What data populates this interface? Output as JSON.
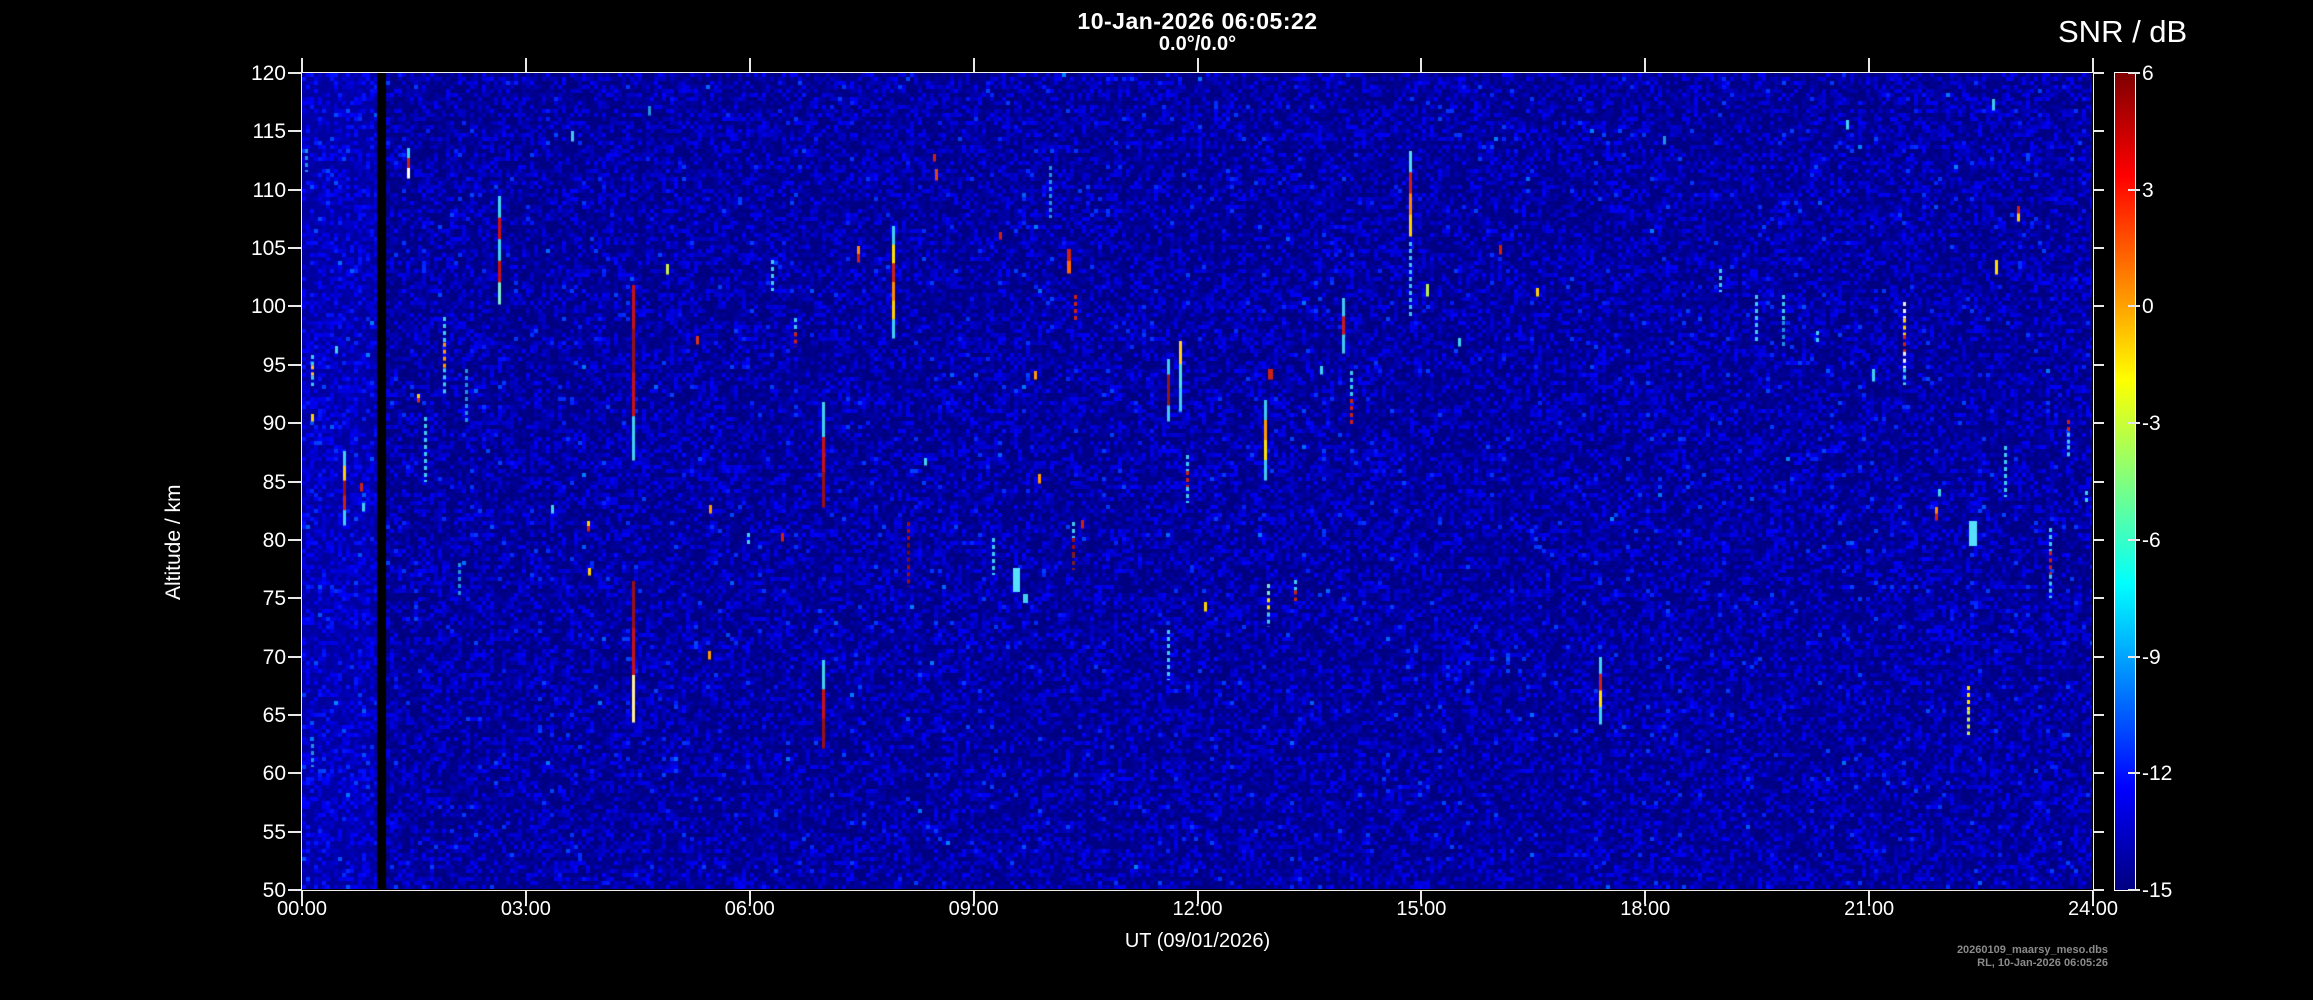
{
  "header": {
    "datetime": "10-Jan-2026 06:05:22",
    "beam": "0.0°/0.0°"
  },
  "colorbar": {
    "title": "SNR / dB",
    "min": -15,
    "max": 6,
    "tick_values": [
      6,
      3,
      0,
      -3,
      -6,
      -9,
      -12,
      -15
    ],
    "colormap": "jet"
  },
  "axes": {
    "y_label": "Altitude / km",
    "y_tick_values": [
      120,
      115,
      110,
      105,
      100,
      95,
      90,
      85,
      80,
      75,
      70,
      65,
      60,
      55,
      50
    ],
    "x_label": "UT (09/01/2026)",
    "x_tick_labels": [
      "00:00",
      "03:00",
      "06:00",
      "09:00",
      "12:00",
      "15:00",
      "18:00",
      "21:00",
      "24:00"
    ],
    "x_tick_hours": [
      0,
      3,
      6,
      9,
      12,
      15,
      18,
      21,
      24
    ]
  },
  "footer": {
    "line1": "20260109_maarsy_meso.dbs",
    "line2": "RL, 10-Jan-2026 06:05:26"
  },
  "colors": {
    "background": "#000000",
    "axis": "#efefef",
    "noise_floor": "#000080",
    "text": "#ffffff",
    "footer_text": "#8a8a8a"
  },
  "chart_data": {
    "type": "heatmap",
    "title": "10-Jan-2026 06:05:22",
    "subtitle": "0.0°/0.0°",
    "xlabel": "UT (09/01/2026)",
    "ylabel": "Altitude / km",
    "zlabel": "SNR / dB",
    "x_range_hours": [
      0,
      24
    ],
    "y_range_km": [
      50,
      120
    ],
    "z_range_db": [
      -15,
      6
    ],
    "colormap": "jet",
    "grid": false,
    "legend_position": "right-colorbar",
    "background_noise_db": -15,
    "dropout_gap_hours": [
      1.005,
      1.126
    ],
    "echoes": [
      {
        "t": 0.05,
        "alt": [
          111.5,
          113.5
        ],
        "colors": [
          "#2090e0"
        ],
        "style": "dash"
      },
      {
        "t": 0.13,
        "alt": [
          93.2,
          95.8
        ],
        "colors": [
          "#40c8f0",
          "#ffc020",
          "#40c8f0"
        ],
        "style": "dash"
      },
      {
        "t": 0.14,
        "alt": [
          90.2,
          90.8
        ],
        "colors": [
          "#ffd000"
        ],
        "style": "solid"
      },
      {
        "t": 0.13,
        "alt": [
          60.5,
          62.5
        ],
        "colors": [
          "#2090e0"
        ],
        "style": "dash"
      },
      {
        "t": 0.45,
        "alt": [
          96.0,
          96.6
        ],
        "colors": [
          "#40d0f0"
        ],
        "style": "solid"
      },
      {
        "t": 0.56,
        "alt": [
          81.3,
          87.6
        ],
        "colors": [
          "#40d0f0",
          "#ffd000",
          "#991111",
          "#cc2211",
          "#40d0f0"
        ],
        "style": "solid"
      },
      {
        "t": 0.79,
        "alt": [
          84.2,
          84.9
        ],
        "colors": [
          "#cc2211"
        ],
        "style": "solid"
      },
      {
        "t": 0.82,
        "alt": [
          82.5,
          83.2
        ],
        "colors": [
          "#40d0f0"
        ],
        "style": "solid"
      },
      {
        "t": 1.42,
        "alt": [
          111.0,
          113.6
        ],
        "colors": [
          "#40d0f0",
          "#cc2211",
          "#ffffff"
        ],
        "style": "solid"
      },
      {
        "t": 1.55,
        "alt": [
          91.8,
          92.5
        ],
        "colors": [
          "#ffd000",
          "#cc3311"
        ],
        "style": "solid"
      },
      {
        "t": 1.65,
        "alt": [
          85.0,
          90.5
        ],
        "colors": [
          "#40c8f0"
        ],
        "style": "dash"
      },
      {
        "t": 1.9,
        "alt": [
          92.5,
          99.1
        ],
        "colors": [
          "#40c8f0",
          "#ff9900",
          "#40c8f0"
        ],
        "style": "dash"
      },
      {
        "t": 2.1,
        "alt": [
          75.0,
          78.0
        ],
        "colors": [
          "#2090e0"
        ],
        "style": "dash"
      },
      {
        "t": 2.2,
        "alt": [
          90.0,
          94.6
        ],
        "colors": [
          "#2090e0"
        ],
        "style": "dash"
      },
      {
        "t": 2.64,
        "alt": [
          100.2,
          109.5
        ],
        "colors": [
          "#40d0f0",
          "#cc1111",
          "#40d0f0",
          "#cc1111",
          "#7fe8d0"
        ],
        "style": "solid"
      },
      {
        "t": 3.35,
        "alt": [
          82.3,
          83.0
        ],
        "colors": [
          "#40d0f0"
        ],
        "style": "solid"
      },
      {
        "t": 3.62,
        "alt": [
          114.2,
          115.0
        ],
        "colors": [
          "#40c8f0"
        ],
        "style": "solid"
      },
      {
        "t": 3.83,
        "alt": [
          80.8,
          81.6
        ],
        "colors": [
          "#ffd000",
          "#cc2211"
        ],
        "style": "solid"
      },
      {
        "t": 3.85,
        "alt": [
          77.0,
          77.6
        ],
        "colors": [
          "#ffd000"
        ],
        "style": "solid"
      },
      {
        "t": 4.44,
        "alt": [
          86.8,
          101.8
        ],
        "colors": [
          "#cc1111",
          "#991111",
          "#cc1111",
          "#40d0f0"
        ],
        "style": "solid"
      },
      {
        "t": 4.44,
        "alt": [
          64.4,
          76.5
        ],
        "colors": [
          "#991111",
          "#cc1111",
          "#ffee99"
        ],
        "style": "solid"
      },
      {
        "t": 4.65,
        "alt": [
          116.4,
          117.2
        ],
        "colors": [
          "#2090e0"
        ],
        "style": "solid"
      },
      {
        "t": 4.89,
        "alt": [
          102.8,
          103.6
        ],
        "colors": [
          "#ccee44"
        ],
        "style": "solid"
      },
      {
        "t": 5.29,
        "alt": [
          96.8,
          97.5
        ],
        "colors": [
          "#dd3311"
        ],
        "style": "solid"
      },
      {
        "t": 5.46,
        "alt": [
          69.8,
          70.5
        ],
        "colors": [
          "#ff9900"
        ],
        "style": "solid"
      },
      {
        "t": 5.47,
        "alt": [
          82.3,
          83.0
        ],
        "colors": [
          "#ff9900"
        ],
        "style": "solid"
      },
      {
        "t": 5.98,
        "alt": [
          79.4,
          80.6
        ],
        "colors": [
          "#40d0f0"
        ],
        "style": "dash"
      },
      {
        "t": 6.3,
        "alt": [
          101.3,
          104.0
        ],
        "colors": [
          "#40c8f0"
        ],
        "style": "dash"
      },
      {
        "t": 6.43,
        "alt": [
          79.9,
          80.6
        ],
        "colors": [
          "#cc2211"
        ],
        "style": "solid"
      },
      {
        "t": 6.6,
        "alt": [
          96.5,
          99.0
        ],
        "colors": [
          "#40c8f0",
          "#cc2211"
        ],
        "style": "dash"
      },
      {
        "t": 6.98,
        "alt": [
          82.8,
          91.8
        ],
        "colors": [
          "#40d0f0",
          "#cc1111",
          "#991111"
        ],
        "style": "solid"
      },
      {
        "t": 6.98,
        "alt": [
          62.2,
          69.7
        ],
        "colors": [
          "#40d0f0",
          "#cc1111",
          "#991111"
        ],
        "style": "solid"
      },
      {
        "t": 7.45,
        "alt": [
          103.8,
          105.2
        ],
        "colors": [
          "#ff8800",
          "#cc2211"
        ],
        "style": "solid"
      },
      {
        "t": 7.92,
        "alt": [
          97.3,
          106.9
        ],
        "colors": [
          "#40d0f0",
          "#ffe000",
          "#cc2211",
          "#ff8800",
          "#ffd000",
          "#40d0f0"
        ],
        "style": "solid"
      },
      {
        "t": 8.12,
        "alt": [
          76.0,
          81.5
        ],
        "colors": [
          "#991111",
          "#701010",
          "#991111"
        ],
        "style": "dash"
      },
      {
        "t": 8.35,
        "alt": [
          86.4,
          87.0
        ],
        "colors": [
          "#40d0f0"
        ],
        "style": "solid"
      },
      {
        "t": 8.47,
        "alt": [
          112.5,
          113.1
        ],
        "colors": [
          "#cc2211"
        ],
        "style": "solid"
      },
      {
        "t": 8.5,
        "alt": [
          110.8,
          111.8
        ],
        "colors": [
          "#dd4411"
        ],
        "style": "solid"
      },
      {
        "t": 9.26,
        "alt": [
          77.0,
          80.2
        ],
        "colors": [
          "#40c8f0"
        ],
        "style": "dash"
      },
      {
        "t": 9.36,
        "alt": [
          105.8,
          106.4
        ],
        "colors": [
          "#cc2211"
        ],
        "style": "solid"
      },
      {
        "t": 9.58,
        "alt": [
          75.5,
          77.6
        ],
        "colors": [
          "#55e0ff"
        ],
        "style": "blob",
        "w": 7
      },
      {
        "t": 9.7,
        "alt": [
          74.6,
          75.4
        ],
        "colors": [
          "#40d0f0"
        ],
        "style": "blob",
        "w": 5
      },
      {
        "t": 9.82,
        "alt": [
          93.8,
          94.5
        ],
        "colors": [
          "#ff9900"
        ],
        "style": "solid"
      },
      {
        "t": 9.88,
        "alt": [
          84.9,
          85.6
        ],
        "colors": [
          "#ff9900"
        ],
        "style": "solid"
      },
      {
        "t": 10.03,
        "alt": [
          107.6,
          112.0
        ],
        "colors": [
          "#2090e0"
        ],
        "style": "dash"
      },
      {
        "t": 10.27,
        "alt": [
          102.9,
          104.9
        ],
        "colors": [
          "#cc2211",
          "#ff6600"
        ],
        "style": "solid",
        "w": 4
      },
      {
        "t": 10.33,
        "alt": [
          77.4,
          81.5
        ],
        "colors": [
          "#40c8f0",
          "#991111",
          "#772222"
        ],
        "style": "dash"
      },
      {
        "t": 10.36,
        "alt": [
          98.6,
          101.0
        ],
        "colors": [
          "#cc2211"
        ],
        "style": "dash"
      },
      {
        "t": 10.45,
        "alt": [
          81.0,
          81.7
        ],
        "colors": [
          "#cc2211"
        ],
        "style": "solid"
      },
      {
        "t": 11.6,
        "alt": [
          90.2,
          95.5
        ],
        "colors": [
          "#40c8f0",
          "#8b1a1a",
          "#8b1a1a",
          "#40c8f0"
        ],
        "style": "solid"
      },
      {
        "t": 11.6,
        "alt": [
          68.0,
          72.3
        ],
        "colors": [
          "#40c8f0"
        ],
        "style": "dash"
      },
      {
        "t": 11.76,
        "alt": [
          91.0,
          97.0
        ],
        "colors": [
          "#ffd020",
          "#50e0e0",
          "#40c8f0"
        ],
        "style": "solid"
      },
      {
        "t": 11.86,
        "alt": [
          83.2,
          87.3
        ],
        "colors": [
          "#40c8f0",
          "#cc2211",
          "#40c8f0"
        ],
        "style": "dash"
      },
      {
        "t": 12.1,
        "alt": [
          73.9,
          74.7
        ],
        "colors": [
          "#ffd000"
        ],
        "style": "solid"
      },
      {
        "t": 12.91,
        "alt": [
          85.1,
          92.0
        ],
        "colors": [
          "#40c8f0",
          "#ff9900",
          "#ffe000",
          "#40c8f0"
        ],
        "style": "solid"
      },
      {
        "t": 12.95,
        "alt": [
          72.5,
          76.2
        ],
        "colors": [
          "#7fe8c0",
          "#ffe000",
          "#40c8f0"
        ],
        "style": "dash"
      },
      {
        "t": 12.96,
        "alt": [
          93.8,
          94.6
        ],
        "colors": [
          "#cc2211"
        ],
        "style": "solid",
        "w": 5
      },
      {
        "t": 13.3,
        "alt": [
          74.8,
          76.6
        ],
        "colors": [
          "#40c8f0",
          "#cc2211"
        ],
        "style": "dash"
      },
      {
        "t": 13.66,
        "alt": [
          94.2,
          94.9
        ],
        "colors": [
          "#40d0f0"
        ],
        "style": "solid"
      },
      {
        "t": 13.95,
        "alt": [
          96.0,
          100.7
        ],
        "colors": [
          "#40c8f0",
          "#cc1818",
          "#40c8f0"
        ],
        "style": "solid"
      },
      {
        "t": 14.06,
        "alt": [
          89.7,
          94.5
        ],
        "colors": [
          "#40c8f0",
          "#cc2211"
        ],
        "style": "dash"
      },
      {
        "t": 14.85,
        "alt": [
          106.0,
          113.3
        ],
        "colors": [
          "#50d8f0",
          "#cc2211",
          "#ff8800",
          "#ffd000"
        ],
        "style": "solid"
      },
      {
        "t": 14.85,
        "alt": [
          99.0,
          105.5
        ],
        "colors": [
          "#40c0e8"
        ],
        "style": "dash"
      },
      {
        "t": 15.08,
        "alt": [
          100.9,
          101.9
        ],
        "colors": [
          "#bbee44"
        ],
        "style": "solid"
      },
      {
        "t": 15.5,
        "alt": [
          96.6,
          97.3
        ],
        "colors": [
          "#40d0f0"
        ],
        "style": "solid"
      },
      {
        "t": 16.05,
        "alt": [
          104.5,
          105.3
        ],
        "colors": [
          "#cc2211"
        ],
        "style": "solid"
      },
      {
        "t": 16.55,
        "alt": [
          100.9,
          101.6
        ],
        "colors": [
          "#ffd000"
        ],
        "style": "solid"
      },
      {
        "t": 17.39,
        "alt": [
          64.2,
          70.0
        ],
        "colors": [
          "#40d0f0",
          "#cc2211",
          "#ffe000",
          "#40d0f0"
        ],
        "style": "solid"
      },
      {
        "t": 18.25,
        "alt": [
          113.9,
          114.6
        ],
        "colors": [
          "#2090e0"
        ],
        "style": "solid"
      },
      {
        "t": 19.0,
        "alt": [
          101.2,
          103.2
        ],
        "colors": [
          "#40c8f0"
        ],
        "style": "dash"
      },
      {
        "t": 19.48,
        "alt": [
          97.0,
          101.0
        ],
        "colors": [
          "#40c8f0"
        ],
        "style": "dash"
      },
      {
        "t": 19.85,
        "alt": [
          96.5,
          101.0
        ],
        "colors": [
          "#40c8f0",
          "#2090e0"
        ],
        "style": "dash"
      },
      {
        "t": 20.3,
        "alt": [
          96.8,
          97.9
        ],
        "colors": [
          "#40c8f0"
        ],
        "style": "dash"
      },
      {
        "t": 20.7,
        "alt": [
          115.2,
          116.0
        ],
        "colors": [
          "#40d0f0"
        ],
        "style": "solid"
      },
      {
        "t": 21.05,
        "alt": [
          93.6,
          94.6
        ],
        "colors": [
          "#40d0f0"
        ],
        "style": "solid"
      },
      {
        "t": 21.47,
        "alt": [
          93.3,
          100.4
        ],
        "colors": [
          "#eeeeee",
          "#ffd000",
          "#cc2211",
          "#eeeeee",
          "#40d0f0"
        ],
        "style": "dash"
      },
      {
        "t": 21.9,
        "alt": [
          81.7,
          82.8
        ],
        "colors": [
          "#ff8800",
          "#cc2211"
        ],
        "style": "solid"
      },
      {
        "t": 21.93,
        "alt": [
          83.8,
          84.4
        ],
        "colors": [
          "#40d0f0"
        ],
        "style": "solid"
      },
      {
        "t": 22.32,
        "alt": [
          63.3,
          67.5
        ],
        "colors": [
          "#ffe000",
          "#ccee44"
        ],
        "style": "dash"
      },
      {
        "t": 22.4,
        "alt": [
          79.5,
          81.6
        ],
        "colors": [
          "#55e0ff"
        ],
        "style": "blob",
        "w": 8
      },
      {
        "t": 22.66,
        "alt": [
          116.8,
          117.8
        ],
        "colors": [
          "#40c8f0"
        ],
        "style": "solid"
      },
      {
        "t": 22.7,
        "alt": [
          102.8,
          104.0
        ],
        "colors": [
          "#ffe000"
        ],
        "style": "solid"
      },
      {
        "t": 22.82,
        "alt": [
          83.7,
          88.0
        ],
        "colors": [
          "#40c8f0"
        ],
        "style": "dash"
      },
      {
        "t": 23.0,
        "alt": [
          107.3,
          108.6
        ],
        "colors": [
          "#cc2211",
          "#ffd000"
        ],
        "style": "solid"
      },
      {
        "t": 23.42,
        "alt": [
          75.0,
          81.0
        ],
        "colors": [
          "#40c8f0",
          "#cc2211",
          "#40c8f0"
        ],
        "style": "dash"
      },
      {
        "t": 23.66,
        "alt": [
          87.0,
          90.3
        ],
        "colors": [
          "#cc2211",
          "#40c8f0",
          "#40c8f0"
        ],
        "style": "dash"
      },
      {
        "t": 23.9,
        "alt": [
          83.0,
          84.2
        ],
        "colors": [
          "#40c8f0"
        ],
        "style": "dash"
      }
    ]
  }
}
